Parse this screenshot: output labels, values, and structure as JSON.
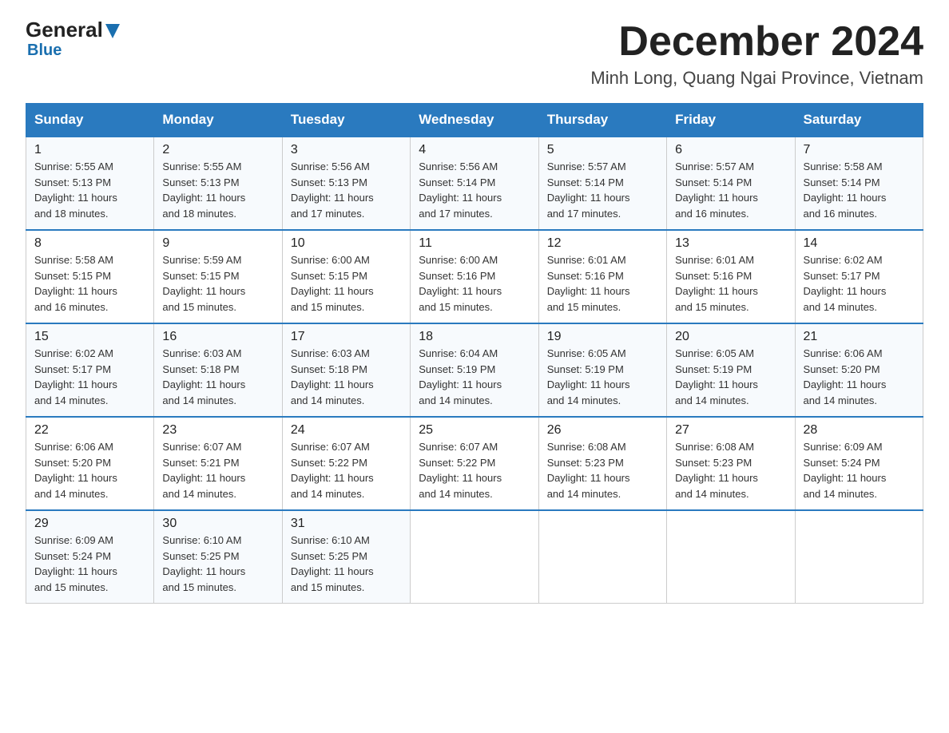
{
  "header": {
    "logo_general": "General",
    "logo_blue": "Blue",
    "month_title": "December 2024",
    "location": "Minh Long, Quang Ngai Province, Vietnam"
  },
  "columns": [
    "Sunday",
    "Monday",
    "Tuesday",
    "Wednesday",
    "Thursday",
    "Friday",
    "Saturday"
  ],
  "weeks": [
    [
      {
        "day": "1",
        "sunrise": "5:55 AM",
        "sunset": "5:13 PM",
        "daylight": "11 hours and 18 minutes."
      },
      {
        "day": "2",
        "sunrise": "5:55 AM",
        "sunset": "5:13 PM",
        "daylight": "11 hours and 18 minutes."
      },
      {
        "day": "3",
        "sunrise": "5:56 AM",
        "sunset": "5:13 PM",
        "daylight": "11 hours and 17 minutes."
      },
      {
        "day": "4",
        "sunrise": "5:56 AM",
        "sunset": "5:14 PM",
        "daylight": "11 hours and 17 minutes."
      },
      {
        "day": "5",
        "sunrise": "5:57 AM",
        "sunset": "5:14 PM",
        "daylight": "11 hours and 17 minutes."
      },
      {
        "day": "6",
        "sunrise": "5:57 AM",
        "sunset": "5:14 PM",
        "daylight": "11 hours and 16 minutes."
      },
      {
        "day": "7",
        "sunrise": "5:58 AM",
        "sunset": "5:14 PM",
        "daylight": "11 hours and 16 minutes."
      }
    ],
    [
      {
        "day": "8",
        "sunrise": "5:58 AM",
        "sunset": "5:15 PM",
        "daylight": "11 hours and 16 minutes."
      },
      {
        "day": "9",
        "sunrise": "5:59 AM",
        "sunset": "5:15 PM",
        "daylight": "11 hours and 15 minutes."
      },
      {
        "day": "10",
        "sunrise": "6:00 AM",
        "sunset": "5:15 PM",
        "daylight": "11 hours and 15 minutes."
      },
      {
        "day": "11",
        "sunrise": "6:00 AM",
        "sunset": "5:16 PM",
        "daylight": "11 hours and 15 minutes."
      },
      {
        "day": "12",
        "sunrise": "6:01 AM",
        "sunset": "5:16 PM",
        "daylight": "11 hours and 15 minutes."
      },
      {
        "day": "13",
        "sunrise": "6:01 AM",
        "sunset": "5:16 PM",
        "daylight": "11 hours and 15 minutes."
      },
      {
        "day": "14",
        "sunrise": "6:02 AM",
        "sunset": "5:17 PM",
        "daylight": "11 hours and 14 minutes."
      }
    ],
    [
      {
        "day": "15",
        "sunrise": "6:02 AM",
        "sunset": "5:17 PM",
        "daylight": "11 hours and 14 minutes."
      },
      {
        "day": "16",
        "sunrise": "6:03 AM",
        "sunset": "5:18 PM",
        "daylight": "11 hours and 14 minutes."
      },
      {
        "day": "17",
        "sunrise": "6:03 AM",
        "sunset": "5:18 PM",
        "daylight": "11 hours and 14 minutes."
      },
      {
        "day": "18",
        "sunrise": "6:04 AM",
        "sunset": "5:19 PM",
        "daylight": "11 hours and 14 minutes."
      },
      {
        "day": "19",
        "sunrise": "6:05 AM",
        "sunset": "5:19 PM",
        "daylight": "11 hours and 14 minutes."
      },
      {
        "day": "20",
        "sunrise": "6:05 AM",
        "sunset": "5:19 PM",
        "daylight": "11 hours and 14 minutes."
      },
      {
        "day": "21",
        "sunrise": "6:06 AM",
        "sunset": "5:20 PM",
        "daylight": "11 hours and 14 minutes."
      }
    ],
    [
      {
        "day": "22",
        "sunrise": "6:06 AM",
        "sunset": "5:20 PM",
        "daylight": "11 hours and 14 minutes."
      },
      {
        "day": "23",
        "sunrise": "6:07 AM",
        "sunset": "5:21 PM",
        "daylight": "11 hours and 14 minutes."
      },
      {
        "day": "24",
        "sunrise": "6:07 AM",
        "sunset": "5:22 PM",
        "daylight": "11 hours and 14 minutes."
      },
      {
        "day": "25",
        "sunrise": "6:07 AM",
        "sunset": "5:22 PM",
        "daylight": "11 hours and 14 minutes."
      },
      {
        "day": "26",
        "sunrise": "6:08 AM",
        "sunset": "5:23 PM",
        "daylight": "11 hours and 14 minutes."
      },
      {
        "day": "27",
        "sunrise": "6:08 AM",
        "sunset": "5:23 PM",
        "daylight": "11 hours and 14 minutes."
      },
      {
        "day": "28",
        "sunrise": "6:09 AM",
        "sunset": "5:24 PM",
        "daylight": "11 hours and 14 minutes."
      }
    ],
    [
      {
        "day": "29",
        "sunrise": "6:09 AM",
        "sunset": "5:24 PM",
        "daylight": "11 hours and 15 minutes."
      },
      {
        "day": "30",
        "sunrise": "6:10 AM",
        "sunset": "5:25 PM",
        "daylight": "11 hours and 15 minutes."
      },
      {
        "day": "31",
        "sunrise": "6:10 AM",
        "sunset": "5:25 PM",
        "daylight": "11 hours and 15 minutes."
      },
      null,
      null,
      null,
      null
    ]
  ],
  "labels": {
    "sunrise": "Sunrise:",
    "sunset": "Sunset:",
    "daylight": "Daylight:"
  }
}
